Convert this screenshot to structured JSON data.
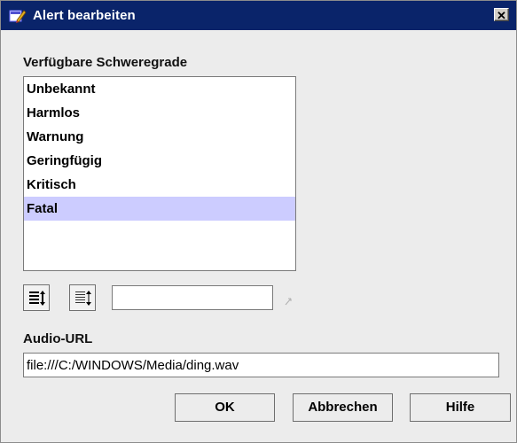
{
  "window": {
    "title": "Alert bearbeiten",
    "close_label": "✕"
  },
  "severity": {
    "label": "Verfügbare Schweregrade",
    "items": [
      "Unbekannt",
      "Harmlos",
      "Warnung",
      "Geringfügig",
      "Kritisch",
      "Fatal"
    ],
    "selected": "Fatal",
    "new_value": ""
  },
  "audio": {
    "label": "Audio-URL",
    "value": "file:///C:/WINDOWS/Media/ding.wav"
  },
  "buttons": {
    "ok": "OK",
    "cancel": "Abbrechen",
    "help": "Hilfe"
  },
  "icons": {
    "app": "alert-edit-icon",
    "close": "close-icon",
    "move_up": "list-sort-filled-icon",
    "move_down": "list-sort-outline-icon",
    "arrow": "small-arrow-icon"
  },
  "colors": {
    "titlebar": "#0a246a",
    "selection": "#ccccff",
    "background": "#ececec"
  }
}
